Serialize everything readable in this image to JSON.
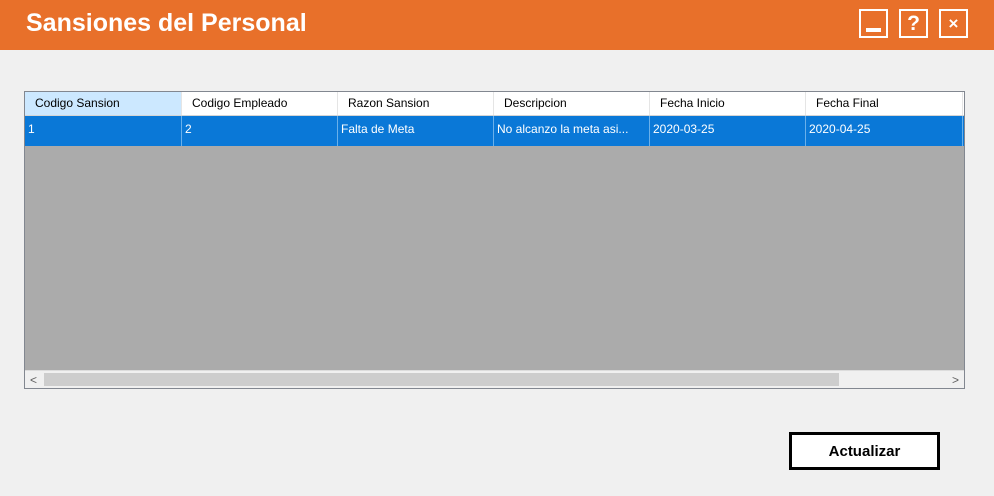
{
  "window": {
    "title": "Sansiones del Personal",
    "title_bar_color": "#e8702a",
    "controls": {
      "minimize_icon": "minimize-icon",
      "help_label": "?",
      "close_label": "×"
    }
  },
  "grid": {
    "columns": [
      "Codigo Sansion",
      "Codigo Empleado",
      "Razon Sansion",
      "Descripcion",
      "Fecha Inicio",
      "Fecha Final"
    ],
    "rows": [
      [
        "1",
        "2",
        "Falta de Meta",
        "No alcanzo la meta asi...",
        "2020-03-25",
        "2020-04-25"
      ]
    ],
    "selection_color": "#0a78d7",
    "scroll_left_label": "<",
    "scroll_right_label": ">"
  },
  "actions": {
    "refresh_label": "Actualizar"
  }
}
